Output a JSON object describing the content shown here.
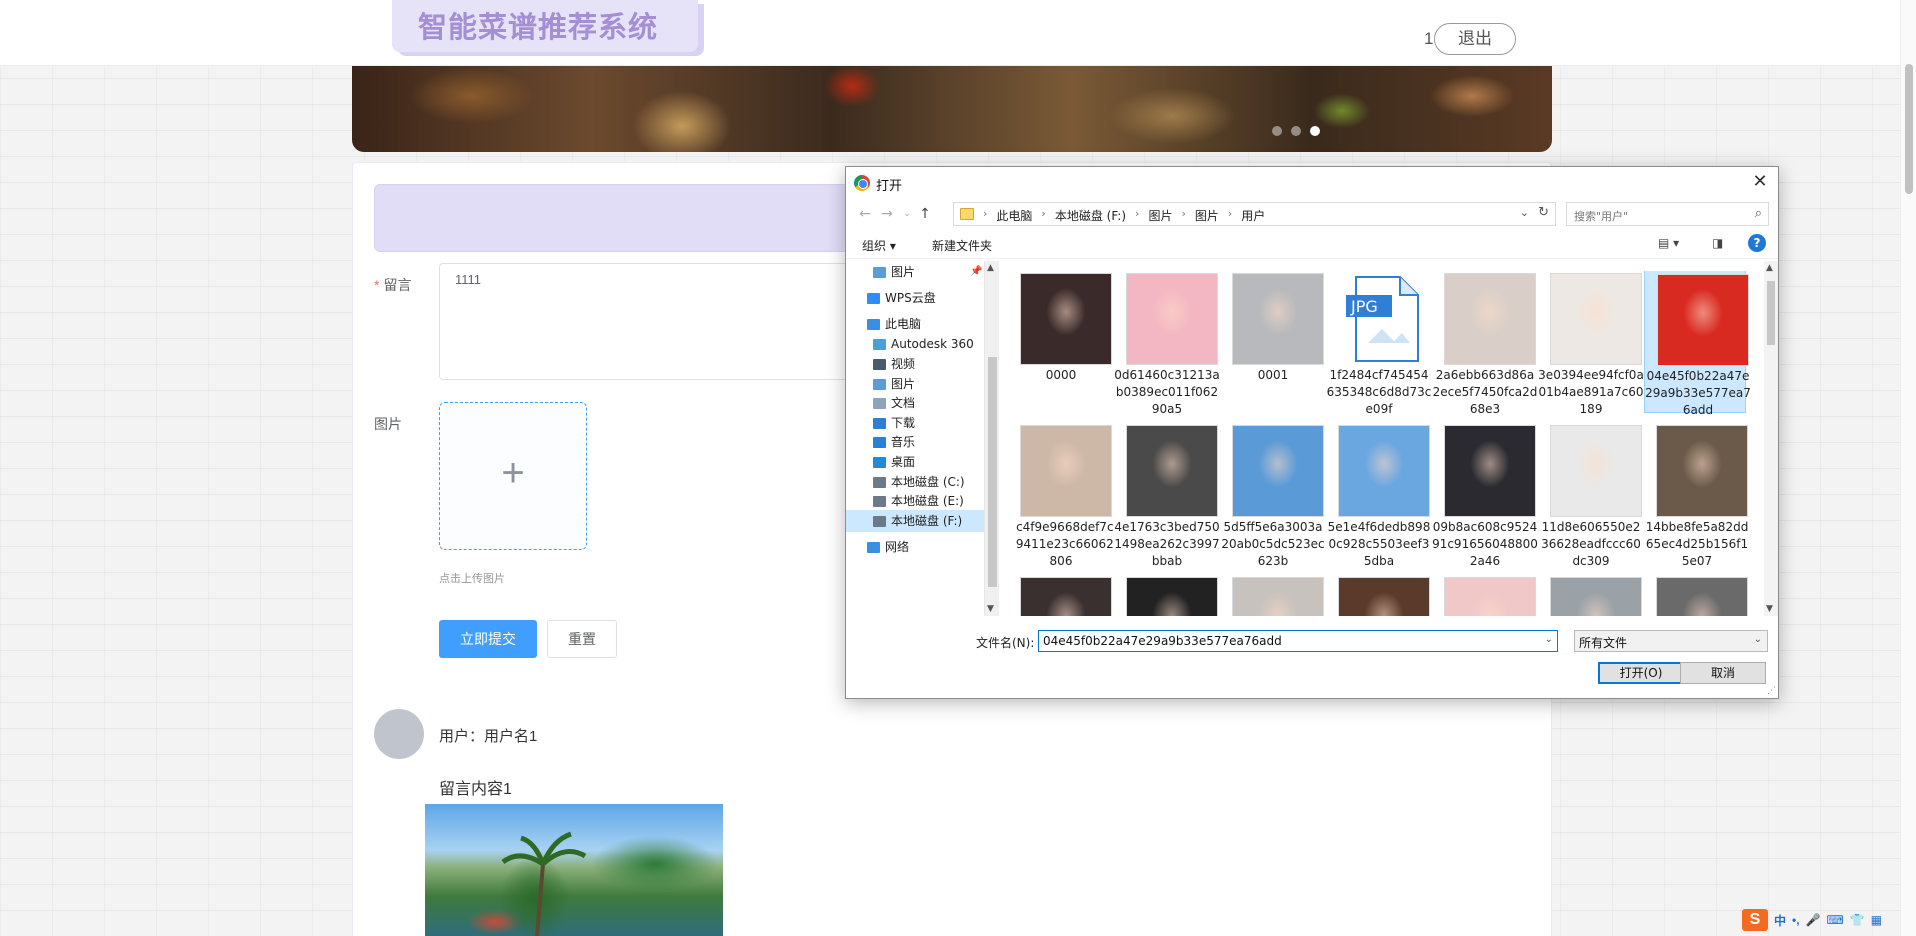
{
  "header": {
    "logo": "智能菜谱推荐系统",
    "user_num": "1",
    "logout": "退出"
  },
  "form": {
    "message_label": "留言",
    "message_value": "1111",
    "image_label": "图片",
    "upload_plus": "+",
    "upload_tip": "点击上传图片",
    "submit": "立即提交",
    "reset": "重置"
  },
  "comment": {
    "user": "用户：用户名1",
    "text": "留言内容1"
  },
  "dialog": {
    "title": "打开",
    "close": "✕",
    "path": [
      "此电脑",
      "本地磁盘 (F:)",
      "图片",
      "图片",
      "用户"
    ],
    "search_placeholder": "搜索\"用户\"",
    "organize": "组织 ▾",
    "new_folder": "新建文件夹",
    "nav": [
      {
        "label": "图片",
        "icon": "pictures-icon",
        "color": "#5a9bd8",
        "indent": 1
      },
      {
        "label": "WPS云盘",
        "icon": "cloud-icon",
        "color": "#2f8ef5",
        "indent": 0
      },
      {
        "label": "此电脑",
        "icon": "computer-icon",
        "color": "#3a8ee6",
        "indent": 0
      },
      {
        "label": "Autodesk 360",
        "icon": "autodesk-icon",
        "color": "#4aa0d8",
        "indent": 1
      },
      {
        "label": "视频",
        "icon": "video-icon",
        "color": "#4b5a6b",
        "indent": 1
      },
      {
        "label": "图片",
        "icon": "pictures-icon",
        "color": "#5a9bd8",
        "indent": 1
      },
      {
        "label": "文档",
        "icon": "documents-icon",
        "color": "#8ea4bd",
        "indent": 1
      },
      {
        "label": "下载",
        "icon": "download-icon",
        "color": "#2a7fd6",
        "indent": 1
      },
      {
        "label": "音乐",
        "icon": "music-icon",
        "color": "#2a7fd6",
        "indent": 1
      },
      {
        "label": "桌面",
        "icon": "desktop-icon",
        "color": "#1f8ad9",
        "indent": 1
      },
      {
        "label": "本地磁盘 (C:)",
        "icon": "drive-icon",
        "color": "#6b7a8a",
        "indent": 1
      },
      {
        "label": "本地磁盘 (E:)",
        "icon": "drive-icon",
        "color": "#6b7a8a",
        "indent": 1
      },
      {
        "label": "本地磁盘 (F:)",
        "icon": "drive-icon",
        "color": "#6b7a8a",
        "indent": 1,
        "selected": true
      },
      {
        "label": "网络",
        "icon": "network-icon",
        "color": "#3a8ee6",
        "indent": 0
      }
    ],
    "files": [
      {
        "name": "0000",
        "bg": "#3a2a2a"
      },
      {
        "name": "0d61460c31213ab0389ec011f06290a5",
        "bg": "#f3b7c3"
      },
      {
        "name": "0001",
        "bg": "#b7b9bd"
      },
      {
        "name": "1f2484cf745454635348c6d8d73ce09f",
        "bg": "#ffffff",
        "jpg": "JPG"
      },
      {
        "name": "2a6ebb663d86a2ece5f7450fca2d68e3",
        "bg": "#d9cfc8"
      },
      {
        "name": "3e0394ee94fcf0a01b4ae891a7c60189",
        "bg": "#eee8e4"
      },
      {
        "name": "04e45f0b22a47e29a9b33e577ea76add",
        "bg": "#d92a22",
        "selected": true
      },
      {
        "name": "4c4f9e9668def7cd9411e23c66062806",
        "bg": "#cdb8a8"
      },
      {
        "name": "4e1763c3bed7501498ea262c3997bbab",
        "bg": "#4a4a4a"
      },
      {
        "name": "5d5ff5e6a3003a20ab0c5dc523ec623b",
        "bg": "#5a9ad6"
      },
      {
        "name": "5e1e4f6dedb8980c928c5503eef35dba",
        "bg": "#6aa6e0"
      },
      {
        "name": "09b8ac608c952491c916560488002a46",
        "bg": "#2a2a30"
      },
      {
        "name": "11d8e606550e236628eadfccc60dc309",
        "bg": "#e9e9e9"
      },
      {
        "name": "14bbe8fe5a82dd65ec4d25b156f15e07",
        "bg": "#6b5a4a"
      },
      {
        "name": "",
        "bg": "#3a3030"
      },
      {
        "name": "",
        "bg": "#222222"
      },
      {
        "name": "",
        "bg": "#c7c2bd"
      },
      {
        "name": "",
        "bg": "#5a3a2a"
      },
      {
        "name": "",
        "bg": "#f0c8c8"
      },
      {
        "name": "",
        "bg": "#9aa2a8"
      },
      {
        "name": "",
        "bg": "#6a6a6a"
      }
    ],
    "filename_label": "文件名(N):",
    "filename_value": "04e45f0b22a47e29a9b33e577ea76add",
    "filetype": "所有文件",
    "open": "打开(O)",
    "cancel": "取消"
  },
  "ime": {
    "logo": "S",
    "items": [
      "中",
      "•,",
      "🎤",
      "⌨",
      "👕",
      "▦"
    ]
  }
}
